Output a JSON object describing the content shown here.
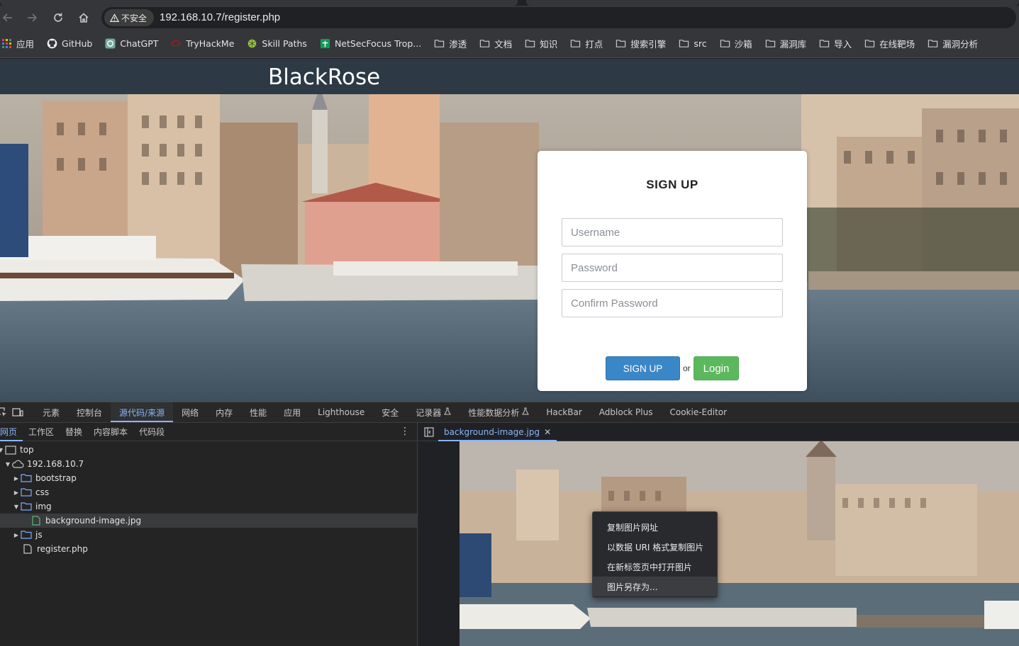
{
  "browser": {
    "security_label": "不安全",
    "url": "192.168.10.7/register.php",
    "bookmarks": [
      {
        "label": "应用",
        "icon": "apps-grid-icon"
      },
      {
        "label": "GitHub",
        "icon": "github-icon"
      },
      {
        "label": "ChatGPT",
        "icon": "chatgpt-icon"
      },
      {
        "label": "TryHackMe",
        "icon": "tryhackme-icon"
      },
      {
        "label": "Skill Paths",
        "icon": "skill-paths-icon"
      },
      {
        "label": "NetSecFocus Trop...",
        "icon": "sheets-icon"
      },
      {
        "label": "渗透",
        "icon": "folder-icon"
      },
      {
        "label": "文档",
        "icon": "folder-icon"
      },
      {
        "label": "知识",
        "icon": "folder-icon"
      },
      {
        "label": "打点",
        "icon": "folder-icon"
      },
      {
        "label": "搜索引擎",
        "icon": "folder-icon"
      },
      {
        "label": "src",
        "icon": "folder-icon"
      },
      {
        "label": "沙箱",
        "icon": "folder-icon"
      },
      {
        "label": "漏洞库",
        "icon": "folder-icon"
      },
      {
        "label": "导入",
        "icon": "folder-icon"
      },
      {
        "label": "在线靶场",
        "icon": "folder-icon"
      },
      {
        "label": "漏洞分析",
        "icon": "folder-icon"
      }
    ]
  },
  "site": {
    "brand": "BlackRose",
    "signup": {
      "title": "SIGN UP",
      "username_placeholder": "Username",
      "password_placeholder": "Password",
      "confirm_placeholder": "Confirm Password",
      "signup_label": "SIGN UP",
      "or_text": "or",
      "login_label": "Login"
    },
    "colors": {
      "header_bg": "#2d3a45",
      "signup_btn": "#3a87c8",
      "login_btn": "#5cb85c"
    }
  },
  "devtools": {
    "main_tabs": [
      "元素",
      "控制台",
      "源代码/来源",
      "网络",
      "内存",
      "性能",
      "应用",
      "Lighthouse",
      "安全",
      "记录器",
      "性能数据分析",
      "HackBar",
      "Adblock Plus",
      "Cookie-Editor"
    ],
    "active_tab": "源代码/来源",
    "sub_tabs": [
      "网页",
      "工作区",
      "替换",
      "内容脚本",
      "代码段"
    ],
    "tree": {
      "top": "top",
      "host": "192.168.10.7",
      "bootstrap": "bootstrap",
      "css": "css",
      "img": "img",
      "bg_file": "background-image.jpg",
      "js": "js",
      "register": "register.php"
    },
    "open_file": "background-image.jpg",
    "context_menu": [
      "复制图片网址",
      "以数据 URI 格式复制图片",
      "在新标签页中打开图片",
      "图片另存为..."
    ],
    "accent": "#8ab4f8"
  }
}
